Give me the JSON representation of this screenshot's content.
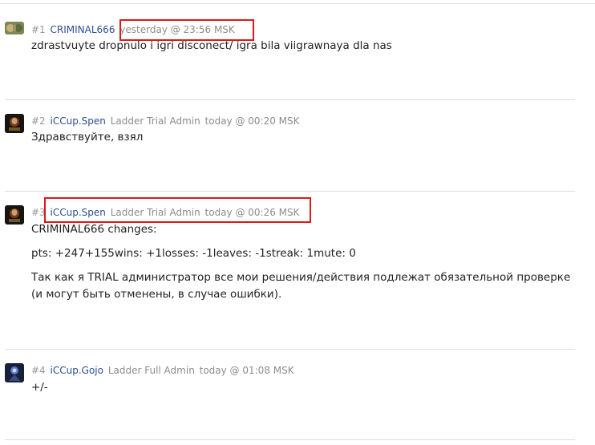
{
  "posts": [
    {
      "number": "#1",
      "user": "CRIMINAL666",
      "role": "",
      "date": "yesterday @ 23:56 MSK",
      "lines": [
        "zdrastvuyte dropnulo i igri disconect/ igra bila viigrawnaya dla nas"
      ]
    },
    {
      "number": "#2",
      "user": "iCCup.Spen",
      "role": "Ladder Trial Admin",
      "date": "today @ 00:20 MSK",
      "lines": [
        "Здравствуйте, взял"
      ]
    },
    {
      "number": "#3",
      "user": "iCCup.Spen",
      "role": "Ladder Trial Admin",
      "date": "today @ 00:26 MSK",
      "lines": [
        "CRIMINAL666 changes:",
        "pts: +247+155wins: +1losses: -1leaves: -1streak: 1mute: 0",
        "Так как я TRIAL администратор все мои решения/действия подлежат обязательной проверке (и могут быть отменены, в случае ошибки)."
      ]
    },
    {
      "number": "#4",
      "user": "iCCup.Gojo",
      "role": "Ladder Full Admin",
      "date": "today @ 01:08 MSK",
      "lines": [
        "+/-"
      ]
    }
  ],
  "colors": {
    "username": "#2c4e8f",
    "meta": "#8c8c8c",
    "highlight": "#e01818"
  }
}
